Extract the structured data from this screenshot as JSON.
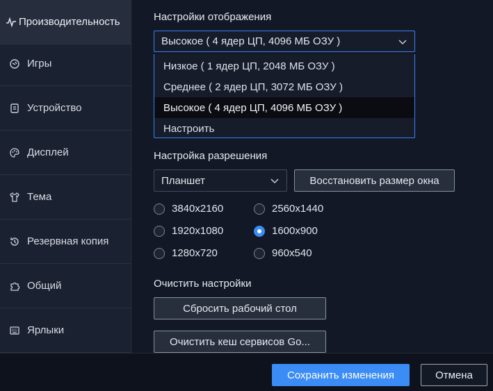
{
  "sidebar": {
    "items": [
      {
        "label": "Производительность",
        "icon": "pulse-icon",
        "active": true
      },
      {
        "label": "Игры",
        "icon": "gamepad-icon"
      },
      {
        "label": "Устройство",
        "icon": "device-icon"
      },
      {
        "label": "Дисплей",
        "icon": "palette-icon"
      },
      {
        "label": "Тема",
        "icon": "shirt-icon"
      },
      {
        "label": "Резервная копия",
        "icon": "history-icon"
      },
      {
        "label": "Общий",
        "icon": "puzzle-icon"
      },
      {
        "label": "Ярлыки",
        "icon": "keyboard-icon"
      }
    ]
  },
  "display": {
    "heading": "Настройки отображения",
    "selected": "Высокое ( 4 ядер ЦП, 4096 МБ ОЗУ )",
    "options": [
      "Низкое ( 1 ядер ЦП, 2048 МБ ОЗУ )",
      "Среднее ( 2 ядер ЦП, 3072 МБ ОЗУ )",
      "Высокое ( 4 ядер ЦП, 4096 МБ ОЗУ )",
      "Настроить"
    ]
  },
  "resolution": {
    "heading": "Настройка разрешения",
    "device_type": "Планшет",
    "restore_button": "Восстановить размер окна",
    "options": [
      "3840x2160",
      "2560x1440",
      "1920x1080",
      "1600x900",
      "1280x720",
      "960x540"
    ],
    "selected": "1600x900"
  },
  "clear": {
    "heading": "Очистить настройки",
    "reset_desktop": "Сбросить рабочий стол",
    "clear_cache": "Очистить кеш сервисов Go..."
  },
  "footer": {
    "save": "Сохранить изменения",
    "cancel": "Отмена"
  },
  "colors": {
    "accent": "#3b8cf5",
    "background": "#121826",
    "sidebar": "#1a2130"
  }
}
